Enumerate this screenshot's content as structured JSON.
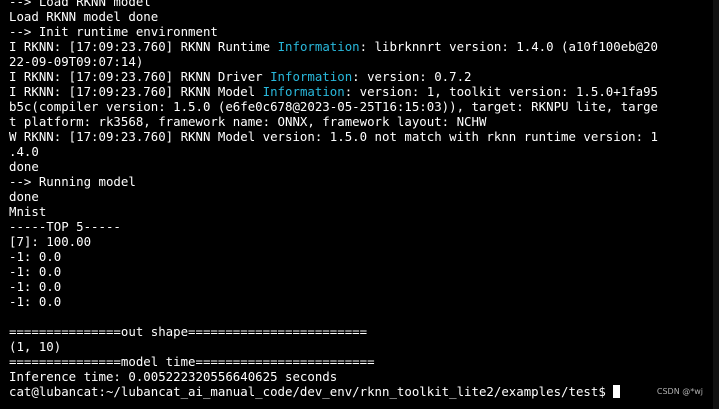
{
  "terminal": {
    "lines": [
      {
        "pre": "--> Load RKNN model",
        "hl": "",
        "post": ""
      },
      {
        "pre": "Load RKNN model done",
        "hl": "",
        "post": ""
      },
      {
        "pre": "--> Init runtime environment",
        "hl": "",
        "post": ""
      },
      {
        "pre": "I RKNN: [17:09:23.760] RKNN Runtime ",
        "hl": "Information",
        "post": ": librknnrt version: 1.4.0 (a10f100eb@20"
      },
      {
        "pre": "22-09-09T09:07:14)",
        "hl": "",
        "post": ""
      },
      {
        "pre": "I RKNN: [17:09:23.760] RKNN Driver ",
        "hl": "Information",
        "post": ": version: 0.7.2"
      },
      {
        "pre": "I RKNN: [17:09:23.760] RKNN Model ",
        "hl": "Information",
        "post": ": version: 1, toolkit version: 1.5.0+1fa95"
      },
      {
        "pre": "b5c(compiler version: 1.5.0 (e6fe0c678@2023-05-25T16:15:03)), target: RKNPU lite, targe",
        "hl": "",
        "post": ""
      },
      {
        "pre": "t platform: rk3568, framework name: ONNX, framework layout: NCHW",
        "hl": "",
        "post": ""
      },
      {
        "pre": "W RKNN: [17:09:23.760] RKNN Model version: 1.5.0 not match with rknn runtime version: 1",
        "hl": "",
        "post": ""
      },
      {
        "pre": ".4.0",
        "hl": "",
        "post": ""
      },
      {
        "pre": "done",
        "hl": "",
        "post": ""
      },
      {
        "pre": "--> Running model",
        "hl": "",
        "post": ""
      },
      {
        "pre": "done",
        "hl": "",
        "post": ""
      },
      {
        "pre": "Mnist",
        "hl": "",
        "post": ""
      },
      {
        "pre": "-----TOP 5-----",
        "hl": "",
        "post": ""
      },
      {
        "pre": "[7]: 100.00",
        "hl": "",
        "post": ""
      },
      {
        "pre": "-1: 0.0",
        "hl": "",
        "post": ""
      },
      {
        "pre": "-1: 0.0",
        "hl": "",
        "post": ""
      },
      {
        "pre": "-1: 0.0",
        "hl": "",
        "post": ""
      },
      {
        "pre": "-1: 0.0",
        "hl": "",
        "post": ""
      },
      {
        "pre": "",
        "hl": "",
        "post": ""
      },
      {
        "pre": "===============out shape========================",
        "hl": "",
        "post": ""
      },
      {
        "pre": "(1, 10)",
        "hl": "",
        "post": ""
      },
      {
        "pre": "===============model time========================",
        "hl": "",
        "post": ""
      },
      {
        "pre": "Inference time: 0.005222320556640625 seconds",
        "hl": "",
        "post": ""
      }
    ],
    "prompt": "cat@lubancat:~/lubancat_ai_manual_code/dev_env/rknn_toolkit_lite2/examples/test$ "
  },
  "colors": {
    "background": "#000000",
    "text": "#ffffff",
    "highlight": "#29b8db"
  },
  "watermark": "CSDN @*wj"
}
